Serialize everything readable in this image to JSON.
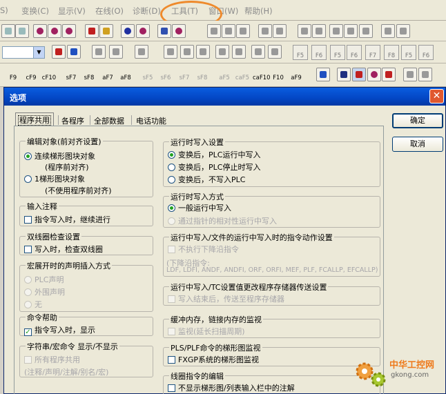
{
  "menubar": {
    "items": [
      {
        "label": "S)"
      },
      {
        "label": "变换(C)"
      },
      {
        "label": "显示(V)"
      },
      {
        "label": "在线(O)"
      },
      {
        "label": "诊断(D)"
      },
      {
        "label": "工具(T)"
      },
      {
        "label": "窗口(W)"
      },
      {
        "label": "帮助(H)"
      }
    ],
    "highlighted": "工具(T)",
    "highlight_color": "#ee8a2c"
  },
  "toolbar": {
    "fkeys_row1": [
      "F5",
      "F6",
      "sF5",
      "sF6",
      "F7",
      "sF7",
      "F8",
      "F9",
      "sF8",
      "aF7",
      "aF8",
      "aF5",
      "caF5",
      "F10",
      "aF9"
    ],
    "fkeys_row2": [
      "F5",
      "F6",
      "F5",
      "F6",
      "F7",
      "F8",
      "F5",
      "F6"
    ],
    "ladder_labels": [
      "F9",
      "cF9",
      "cF10",
      "sF7",
      "sF8",
      "aF7",
      "aF8",
      "sF5",
      "sF6",
      "sF7",
      "sF8",
      "aF5",
      "caF5",
      "caF10",
      "F10",
      "aF9"
    ]
  },
  "dialog": {
    "title": "选项",
    "close_label": "✕",
    "tabs": [
      "程序共用",
      "各程序",
      "全部数据",
      "电话功能"
    ],
    "active_tab": "程序共用",
    "ok_label": "确定",
    "cancel_label": "取消",
    "left": {
      "edit_target": {
        "title": "编辑对象(前对齐设置)",
        "opt1": "连续梯形图块对象",
        "opt1_sub": "(程序前对齐)",
        "opt2": "1梯形图块对象",
        "opt2_sub": "(不使用程序前对齐)",
        "selected": "连续梯形图块对象"
      },
      "input_comment": {
        "title": "输入注释",
        "item": "指令写入时，继续进行",
        "checked": false
      },
      "double_coil": {
        "title": "双线圈检查设置",
        "item": "写入时，检查双线圈",
        "checked": false
      },
      "macro_decl": {
        "title": "宏展开时的声明插入方式",
        "opt1": "PLC声明",
        "opt2": "外围声明",
        "opt3": "无",
        "enabled": false
      },
      "cmd_help": {
        "title": "命令帮助",
        "item": "指令写入时，显示",
        "checked": true
      },
      "string_macro": {
        "title": "字符串/宏命令  显示/不显示",
        "item": "所有程序共用",
        "note": "(注释/声明/注解/别名/宏)",
        "checked": false
      }
    },
    "right": {
      "online_write": {
        "title": "运行时写入设置",
        "opt1": "变换后，PLC运行中写入",
        "opt2": "变换后，PLC停止时写入",
        "opt3": "变换后，不写入PLC",
        "selected": "变换后，PLC运行中写入"
      },
      "online_mode": {
        "title": "运行时写入方式",
        "opt1": "一般运行中写入",
        "opt2": "通过指针的相对性运行中写入",
        "selected": "一般运行中写入"
      },
      "file_online": {
        "title": "运行中写入/文件的运行中写入时的指令动作设置",
        "item": "不执行下降沿指令",
        "note1": "(下降沿指令:",
        "note2": "LDF, LDFI, ANDF, ANDFI, ORF, ORFI, MEF, PLF, FCALLP, EFCALLP)",
        "checked": false
      },
      "tc_write": {
        "title": "运行中写入/TC设置值更改程序存储器传送设置",
        "item": "写入结束后，传送至程序存储器",
        "checked": false
      },
      "buffer_monitor": {
        "title": "缓冲内存，链接内存的监视",
        "item": "监视(延长扫描周期)",
        "checked": false
      },
      "pls_monitor": {
        "title": "PLS/PLF命令的梯形图监视",
        "item": "FXGP系统的梯形图监视",
        "checked": false
      },
      "ladder_edit": {
        "title": "线圈指令的编辑",
        "item": "不显示梯形图/列表输入栏中的注解",
        "checked": false
      }
    }
  },
  "watermark": {
    "line1": "中华工控网",
    "line2": "gkong.com"
  }
}
